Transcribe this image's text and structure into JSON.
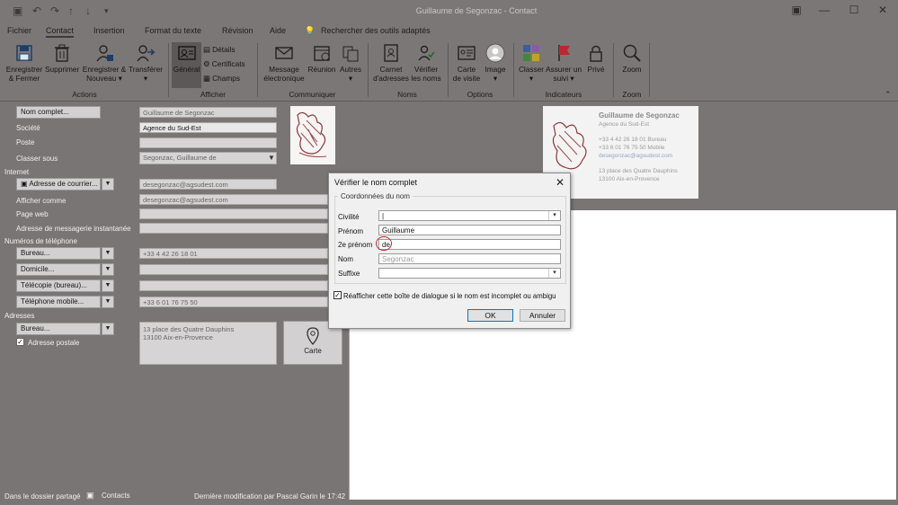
{
  "window": {
    "title": "Guillaume de Segonzac  -  Contact",
    "minimize": "—",
    "maximize": "☐",
    "close": "✕"
  },
  "menu": {
    "tabs": [
      "Fichier",
      "Contact",
      "Insertion",
      "Format du texte",
      "Révision",
      "Aide"
    ],
    "active": "Contact",
    "search": "Rechercher des outils adaptés"
  },
  "ribbon": {
    "actions": {
      "label": "Actions",
      "save_close": [
        "Enregistrer",
        "& Fermer"
      ],
      "delete": "Supprimer",
      "save_new": [
        "Enregistrer &",
        "Nouveau"
      ],
      "forward": "Transférer"
    },
    "show": {
      "label": "Afficher",
      "general": "Général",
      "details": "Détails",
      "certificates": "Certificats",
      "fields": "Champs"
    },
    "communicate": {
      "label": "Communiquer",
      "email": [
        "Message",
        "électronique"
      ],
      "meeting": "Réunion",
      "more": "Autres"
    },
    "names": {
      "label": "Noms",
      "address_book": [
        "Carnet",
        "d'adresses"
      ],
      "check_names": [
        "Vérifier",
        "les noms"
      ]
    },
    "options": {
      "label": "Options",
      "business_card": [
        "Carte",
        "de visite"
      ],
      "picture": "Image"
    },
    "tags": {
      "label": "Indicateurs",
      "categorize": "Classer",
      "follow_up": [
        "Assurer un",
        "suivi"
      ],
      "private": "Privé"
    },
    "zoom": {
      "label": "Zoom",
      "zoom": "Zoom"
    }
  },
  "form": {
    "full_name_btn": "Nom complet...",
    "full_name_value": "Guillaume de Segonzac",
    "company_label": "Société",
    "company_value": "Agence du Sud-Est",
    "job_label": "Poste",
    "file_as_label": "Classer sous",
    "file_as_value": "Segonzac, Guillaume de",
    "internet_section": "Internet",
    "email_btn": "Adresse de courrier...",
    "email_value": "desegonzac@agsudest.com",
    "display_as_label": "Afficher comme",
    "display_as_value": "desegonzac@agsudest.com",
    "web_label": "Page web",
    "im_label": "Adresse de messagerie instantanée",
    "phones_section": "Numéros de téléphone",
    "phone_business_btn": "Bureau...",
    "phone_business_value": "+33 4 42 26 18 01",
    "phone_home_btn": "Domicile...",
    "phone_fax_btn": "Télécopie (bureau)...",
    "phone_mobile_btn": "Téléphone mobile...",
    "phone_mobile_value": "+33 6 01 76 75 50",
    "addresses_section": "Adresses",
    "address_btn": "Bureau...",
    "address_lines": [
      "13 place des Quatre Dauphins",
      "13100  Aix-en-Provence"
    ],
    "mailing_address_label": "Adresse postale",
    "map_label": "Carte"
  },
  "business_card": {
    "name": "Guillaume de Segonzac",
    "company": "Agence du Sud-Est",
    "phone1": "+33 4 42 26 18 01 Bureau",
    "phone2": "+33 6 01 76 75 50 Mobile",
    "email": "desegonzac@agsudest.com",
    "address1": "13 place des Quatre Dauphins",
    "address2": "13100  Aix-en-Provence"
  },
  "dialog": {
    "title": "Vérifier le nom complet",
    "group_title": "Coordonnées du nom",
    "civility_label": "Civilité",
    "civility_value": "",
    "first_label": "Prénom",
    "first_value": "Guillaume",
    "middle_label": "2e prénom",
    "middle_value": "de",
    "last_label": "Nom",
    "last_value": "Segonzac",
    "suffix_label": "Suffixe",
    "suffix_value": "",
    "checkbox_label": "Réafficher cette boîte de dialogue si le nom est incomplet ou ambigu",
    "ok": "OK",
    "cancel": "Annuler"
  },
  "status": {
    "folder": "Dans le dossier partagé",
    "folder_name": "Contacts",
    "modified": "Dernière modification par Pascal Garin le 17:42"
  },
  "colors": {
    "highlight_circle": "#c0262d",
    "accent": "#0078d7"
  }
}
